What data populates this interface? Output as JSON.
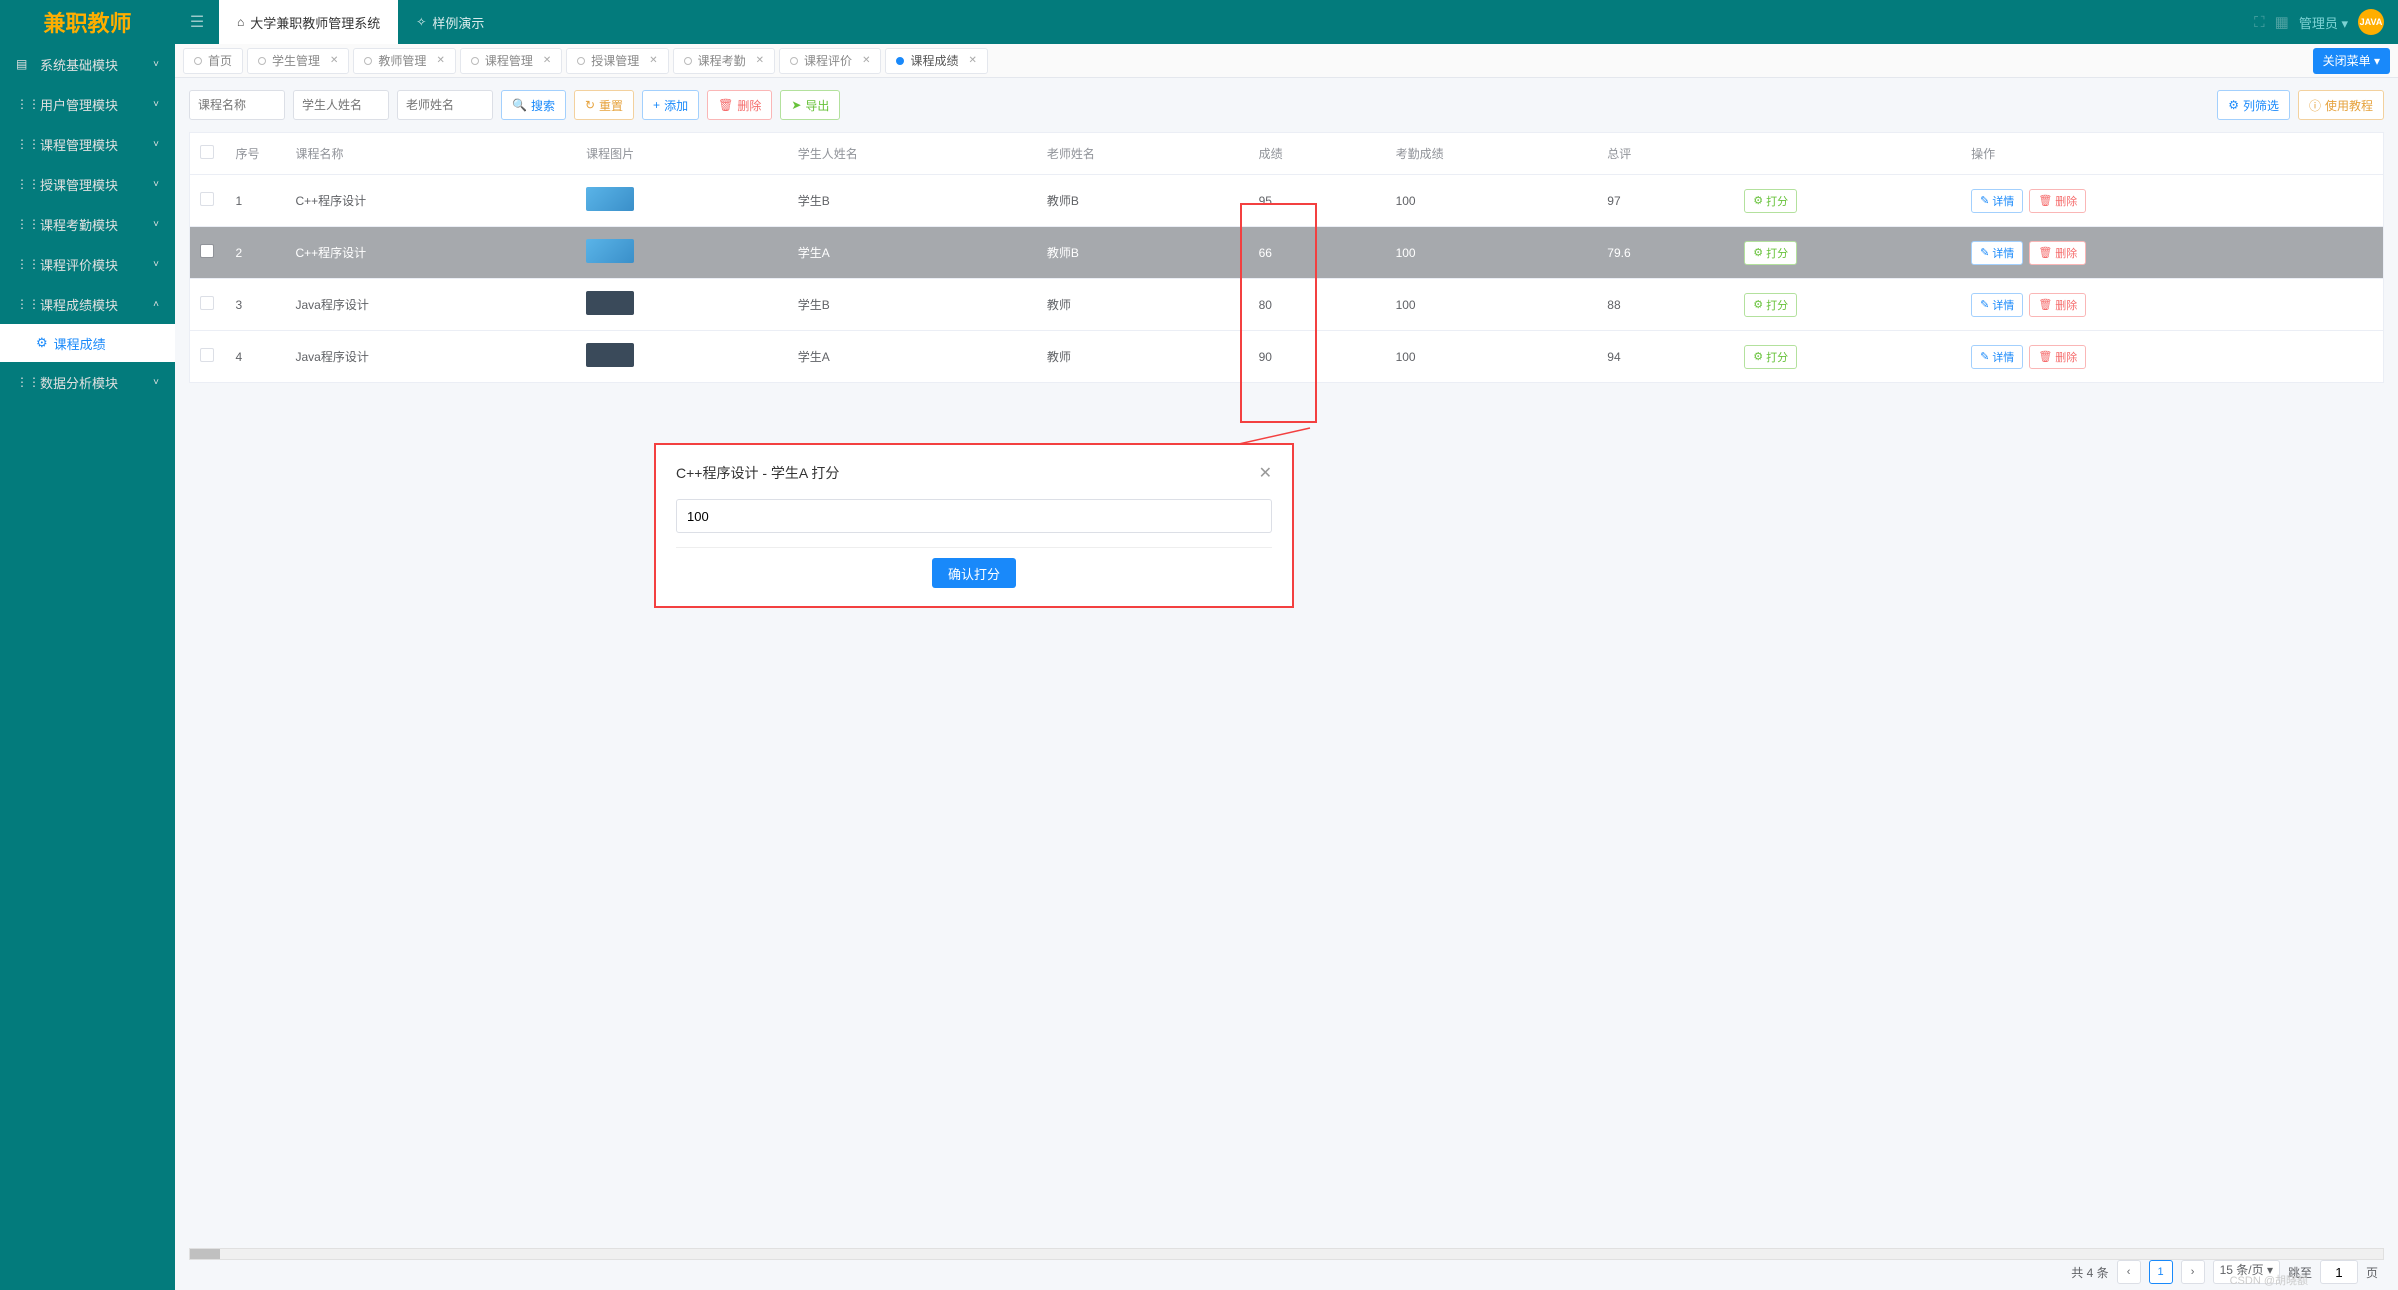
{
  "logo_text": "兼职教师",
  "top_tabs": [
    {
      "icon": "⌂",
      "label": "大学兼职教师管理系统"
    },
    {
      "icon": "✧",
      "label": "样例演示"
    }
  ],
  "user_name": "管理员 ▾",
  "avatar_text": "JAVA",
  "sidebar_items": [
    {
      "icon": "▤",
      "label": "系统基础模块",
      "open": false
    },
    {
      "icon": "⋮⋮",
      "label": "用户管理模块",
      "open": false
    },
    {
      "icon": "⋮⋮",
      "label": "课程管理模块",
      "open": false
    },
    {
      "icon": "⋮⋮",
      "label": "授课管理模块",
      "open": false
    },
    {
      "icon": "⋮⋮",
      "label": "课程考勤模块",
      "open": false
    },
    {
      "icon": "⋮⋮",
      "label": "课程评价模块",
      "open": false
    },
    {
      "icon": "⋮⋮",
      "label": "课程成绩模块",
      "open": true
    },
    {
      "icon": "⋮⋮",
      "label": "数据分析模块",
      "open": false
    }
  ],
  "sidebar_sub": {
    "icon": "⚙",
    "label": "课程成绩"
  },
  "page_tabs": [
    {
      "label": "首页",
      "closable": false,
      "active": false
    },
    {
      "label": "学生管理",
      "closable": true,
      "active": false
    },
    {
      "label": "教师管理",
      "closable": true,
      "active": false
    },
    {
      "label": "课程管理",
      "closable": true,
      "active": false
    },
    {
      "label": "授课管理",
      "closable": true,
      "active": false
    },
    {
      "label": "课程考勤",
      "closable": true,
      "active": false
    },
    {
      "label": "课程评价",
      "closable": true,
      "active": false
    },
    {
      "label": "课程成绩",
      "closable": true,
      "active": true
    }
  ],
  "close_menu_label": "关闭菜单 ▾",
  "filters": {
    "course_ph": "课程名称",
    "student_ph": "学生人姓名",
    "teacher_ph": "老师姓名"
  },
  "toolbar_btns": {
    "search": "搜索",
    "reset": "重置",
    "add": "添加",
    "delete": "删除",
    "export": "导出",
    "col_filter": "列筛选",
    "tutorial": "使用教程"
  },
  "table": {
    "columns": [
      "",
      "序号",
      "课程名称",
      "课程图片",
      "学生人姓名",
      "老师姓名",
      "成绩",
      "考勤成绩",
      "总评",
      "",
      "操作"
    ],
    "rows": [
      {
        "seq": "1",
        "course": "C++程序设计",
        "thumb": "b",
        "student": "学生B",
        "teacher": "教师B",
        "score": "95",
        "attend": "100",
        "total": "97",
        "selected": false
      },
      {
        "seq": "2",
        "course": "C++程序设计",
        "thumb": "b",
        "student": "学生A",
        "teacher": "教师B",
        "score": "66",
        "attend": "100",
        "total": "79.6",
        "selected": true
      },
      {
        "seq": "3",
        "course": "Java程序设计",
        "thumb": "d",
        "student": "学生B",
        "teacher": "教师",
        "score": "80",
        "attend": "100",
        "total": "88",
        "selected": false
      },
      {
        "seq": "4",
        "course": "Java程序设计",
        "thumb": "d",
        "student": "学生A",
        "teacher": "教师",
        "score": "90",
        "attend": "100",
        "total": "94",
        "selected": false
      }
    ],
    "row_btns": {
      "grade": "打分",
      "detail": "详情",
      "delete": "删除"
    }
  },
  "popup": {
    "title": "C++程序设计 - 学生A 打分",
    "value": "100",
    "confirm": "确认打分"
  },
  "pagination": {
    "total_label": "共 4 条",
    "page": "1",
    "size": "15 条/页 ▾",
    "jump_label": "跳至",
    "jump_val": "1",
    "page_suffix": "页"
  },
  "watermark": "CSDN @胡晓额"
}
